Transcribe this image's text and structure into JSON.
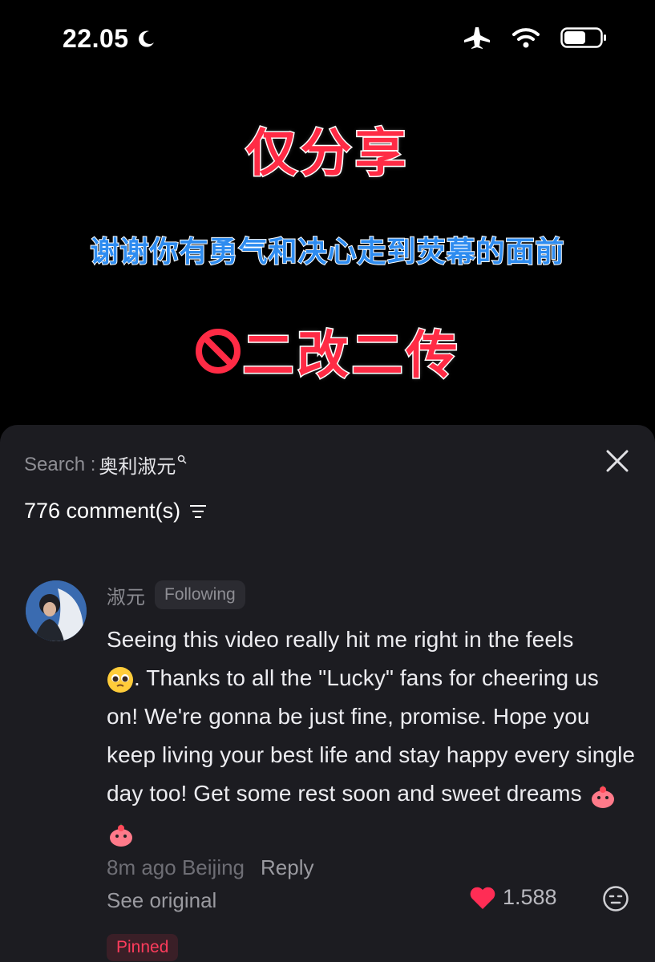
{
  "status_bar": {
    "time": "22.05"
  },
  "video": {
    "line1": "仅分享",
    "line2": "谢谢你有勇气和决心走到荧幕的面前",
    "line3": "二改二传"
  },
  "sheet": {
    "search_label": "Search :",
    "search_keyword": "奥利淑元",
    "comment_count": "776 comment(s)"
  },
  "comment": {
    "author": "淑元",
    "follow_label": "Following",
    "text_parts": {
      "p1": "Seeing this video really hit me right in the feels",
      "p2": ". Thanks to all the \"Lucky\" fans for cheering us on! We're gonna be just fine, promise. Hope you keep living your best life and stay happy every single day too! Get some rest soon and sweet dreams"
    },
    "time": "8m ago",
    "location": "Beijing",
    "reply_label": "Reply",
    "see_original": "See original",
    "pinned_label": "Pinned",
    "likes": "1.588"
  },
  "colors": {
    "accent_red": "#ff2b45",
    "accent_blue": "#2e8cf0",
    "sheet_bg": "#1c1c21",
    "like_red": "#ff2d55"
  },
  "icons": [
    "moon-icon",
    "airplane-icon",
    "wifi-icon",
    "battery-icon",
    "no-entry-icon",
    "mini-search-icon",
    "close-icon",
    "sort-icon",
    "pleading-face-emoji",
    "mascot-emoji",
    "heart-icon",
    "emoji-picker-icon"
  ]
}
